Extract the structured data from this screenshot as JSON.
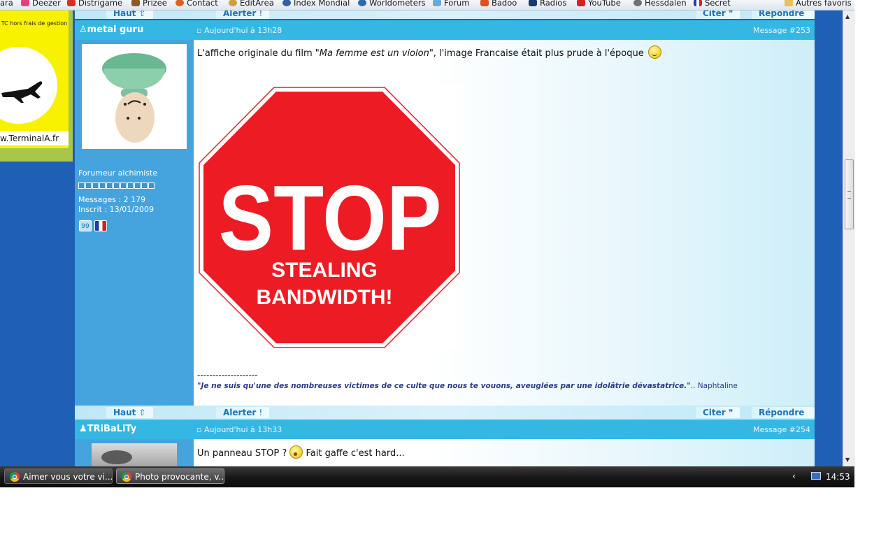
{
  "bookmarks": [
    {
      "label": "ara"
    },
    {
      "label": "Deezer"
    },
    {
      "label": "Distrigame"
    },
    {
      "label": "Prizee"
    },
    {
      "label": "Contact"
    },
    {
      "label": "EditArea"
    },
    {
      "label": "Index Mondial"
    },
    {
      "label": "Worldometers"
    },
    {
      "label": "Forum"
    },
    {
      "label": "Badoo"
    },
    {
      "label": "Radios"
    },
    {
      "label": "YouTube"
    },
    {
      "label": "Hessdalen"
    },
    {
      "label": "Secret"
    }
  ],
  "other_bookmarks": "Autres favoris",
  "ad": {
    "top_text": "TC hors frais de gestion",
    "url_text": "w.TerminalA.fr"
  },
  "actions": {
    "top": "Haut",
    "alert": "Alerter",
    "quote": "Citer",
    "reply": "Répondre"
  },
  "post1": {
    "username": "metal guru",
    "date": "Aujourd'hui à 13h28",
    "message_no": "Message #253",
    "rank": "Forumeur alchimiste",
    "messages": "Messages : 2 179",
    "joined": "Inscrit : 13/01/2009",
    "badge": "99",
    "text_before": "L'affiche originale du film \"",
    "text_italic": "Ma femme est un violon",
    "text_after": "\", l'image Francaise était plus prude à l'époque",
    "image_main": "STOP",
    "image_sub1": "STEALING",
    "image_sub2": "BANDWIDTH!",
    "signature_rule": "--------------------",
    "signature_quote": "\"Je ne suis qu'une des nombreuses victimes de ce culte que nous te vouons, aveuglées par une idolâtrie dévastatrice.\"",
    "signature_author": ".. Naphtaline"
  },
  "post2": {
    "username": "TRiBaLiTy",
    "date": "Aujourd'hui à 13h33",
    "message_no": "Message #254",
    "text_before": "Un panneau STOP ?",
    "text_after": "Fait gaffe c'est hard..."
  },
  "taskbar": {
    "tasks": [
      {
        "label": "Aimer vous votre vi..."
      },
      {
        "label": "Photo provocante, v..."
      }
    ],
    "clock": "14:53"
  },
  "colors": {
    "page_bg": "#1f60b6",
    "header_bg": "#35b7e3",
    "profile_bg": "#45a4dd",
    "stop_red": "#ed1c24"
  }
}
